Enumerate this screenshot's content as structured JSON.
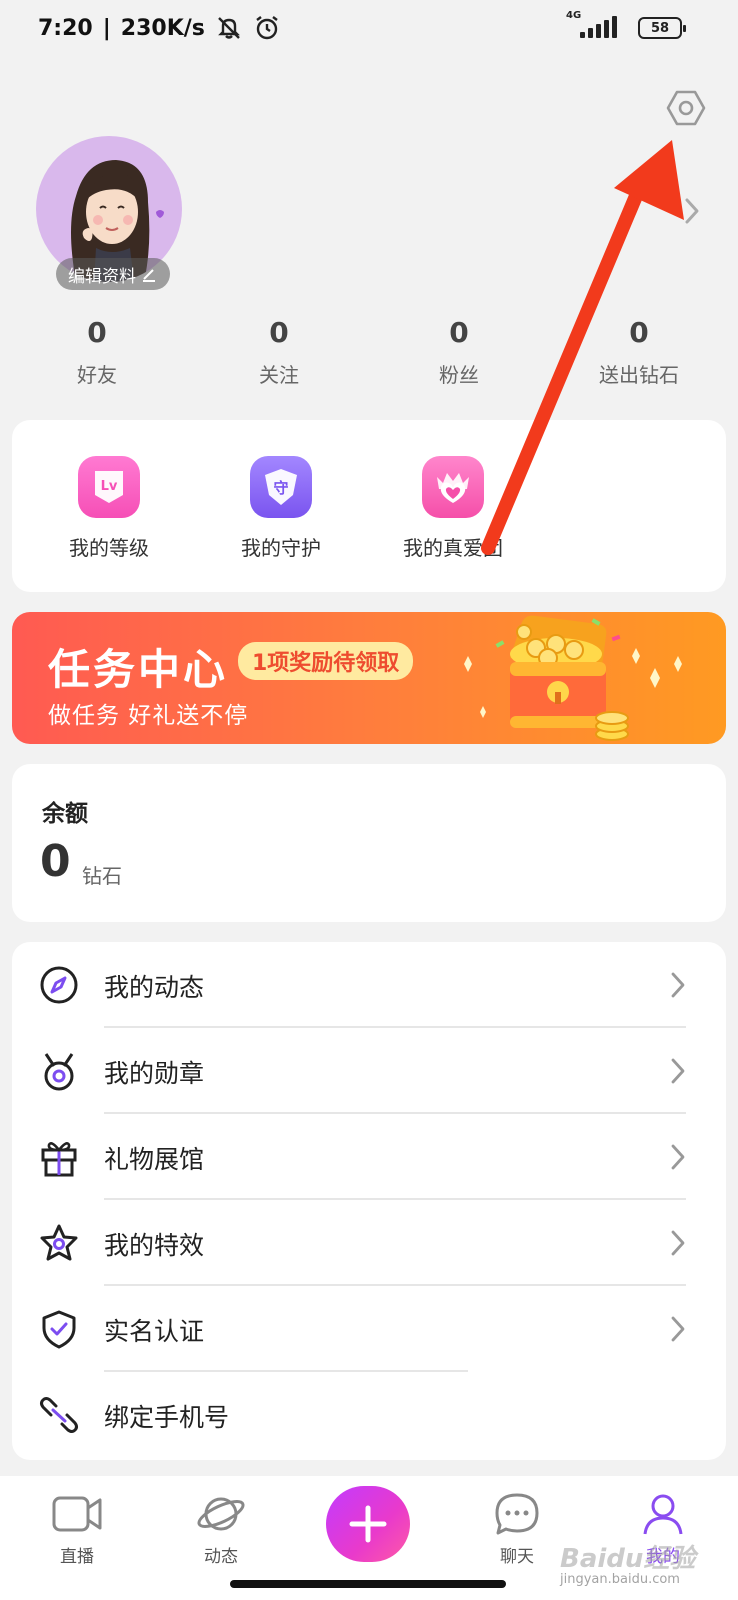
{
  "status_bar": {
    "time": "7:20",
    "separator": "|",
    "speed": "230K/s",
    "network_type": "4G",
    "battery": "58"
  },
  "profile": {
    "edit_label": "编辑资料",
    "stats": [
      {
        "value": "0",
        "label": "好友"
      },
      {
        "value": "0",
        "label": "关注"
      },
      {
        "value": "0",
        "label": "粉丝"
      },
      {
        "value": "0",
        "label": "送出钻石"
      }
    ]
  },
  "quick_actions": [
    {
      "label": "我的等级",
      "icon": "level-icon",
      "color": "#ff5fc3",
      "glyph": "Lv"
    },
    {
      "label": "我的守护",
      "icon": "guard-icon",
      "color": "#8a63f5",
      "glyph": "守"
    },
    {
      "label": "我的真爱团",
      "icon": "true-love-icon",
      "color": "#ff5fb2",
      "glyph": "♥"
    }
  ],
  "task_center": {
    "title": "任务中心",
    "badge": "1项奖励待领取",
    "subtitle": "做任务 好礼送不停"
  },
  "balance": {
    "title": "余额",
    "value": "0",
    "unit": "钻石"
  },
  "menu": [
    {
      "label": "我的动态",
      "icon": "compass-icon"
    },
    {
      "label": "我的勋章",
      "icon": "medal-icon"
    },
    {
      "label": "礼物展馆",
      "icon": "gift-icon"
    },
    {
      "label": "我的特效",
      "icon": "star-icon"
    },
    {
      "label": "实名认证",
      "icon": "shield-check-icon"
    },
    {
      "label": "绑定手机号",
      "icon": "link-icon"
    }
  ],
  "bottom_nav": [
    {
      "label": "直播",
      "icon": "camera-icon"
    },
    {
      "label": "动态",
      "icon": "planet-icon"
    },
    {
      "label": "聊天",
      "icon": "chat-icon"
    },
    {
      "label": "我的",
      "icon": "person-icon"
    }
  ],
  "colors": {
    "accent_purple": "#8a4cf0",
    "task_gradient_start": "#ff5a52",
    "task_gradient_end": "#ff9a22",
    "annotation_arrow": "#f23a1c"
  },
  "watermark": {
    "brand": "Baidu经验",
    "url": "jingyan.baidu.com"
  }
}
